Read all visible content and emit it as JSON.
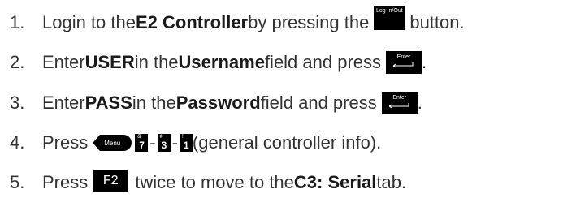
{
  "steps": [
    {
      "num": "1.",
      "t1": "Login to the ",
      "b1": "E2 Controller",
      "t2": " by pressing the ",
      "key": "Log In/Out",
      "t3": " button."
    },
    {
      "num": "2.",
      "t1": "Enter ",
      "b1": "USER",
      "t2": " in the ",
      "b2": "Username",
      "t3": " field and press ",
      "key": "Enter",
      "t4": "."
    },
    {
      "num": "3.",
      "t1": "Enter ",
      "b1": "PASS",
      "t2": " in the ",
      "b2": "Password",
      "t3": " field and press ",
      "key": "Enter",
      "t4": "."
    },
    {
      "num": "4.",
      "t1": "Press ",
      "menu_key": "Menu",
      "keys": [
        {
          "symbol": "&",
          "digit": "7"
        },
        {
          "symbol": "#",
          "digit": "3"
        },
        {
          "symbol": "!",
          "digit": "1"
        }
      ],
      "separator": "-",
      "t2": " (general controller info)."
    },
    {
      "num": "5.",
      "t1": "Press ",
      "key": "F2",
      "t2": "twice to move to the ",
      "b1": "C3: Serial",
      "t3": " tab."
    }
  ]
}
